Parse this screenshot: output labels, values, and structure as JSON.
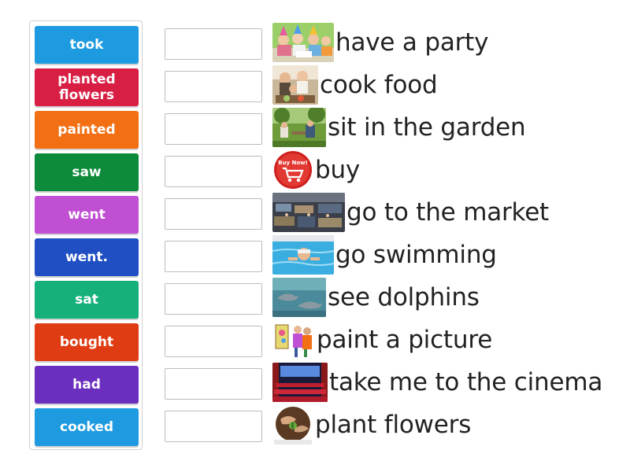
{
  "tiles": [
    {
      "label": "took",
      "color": "#1e9be0"
    },
    {
      "label": "planted flowers",
      "color": "#d81f43"
    },
    {
      "label": "painted",
      "color": "#f26f14"
    },
    {
      "label": "saw",
      "color": "#0d8a3a"
    },
    {
      "label": "went",
      "color": "#c04fd4"
    },
    {
      "label": "went.",
      "color": "#1f4fc3"
    },
    {
      "label": "sat",
      "color": "#16b07a"
    },
    {
      "label": "bought",
      "color": "#df3c14"
    },
    {
      "label": "had",
      "color": "#6b2fc0"
    },
    {
      "label": "cooked",
      "color": "#1e9be0"
    }
  ],
  "targets": [
    {
      "text": "have a party",
      "icon": "party-photo-icon"
    },
    {
      "text": "cook food",
      "icon": "family-cooking-photo-icon"
    },
    {
      "text": "sit in the garden",
      "icon": "garden-photo-icon"
    },
    {
      "text": "buy",
      "icon": "buy-now-cart-icon",
      "badge_text": "Buy Now!"
    },
    {
      "text": "go to the market",
      "icon": "market-photo-icon"
    },
    {
      "text": "go swimming",
      "icon": "swimming-photo-icon"
    },
    {
      "text": "see dolphins",
      "icon": "dolphins-photo-icon"
    },
    {
      "text": "paint a picture",
      "icon": "painting-clipart-icon"
    },
    {
      "text": "take me to the cinema",
      "icon": "cinema-photo-icon"
    },
    {
      "text": "plant flowers",
      "icon": "planting-photo-icon"
    }
  ]
}
